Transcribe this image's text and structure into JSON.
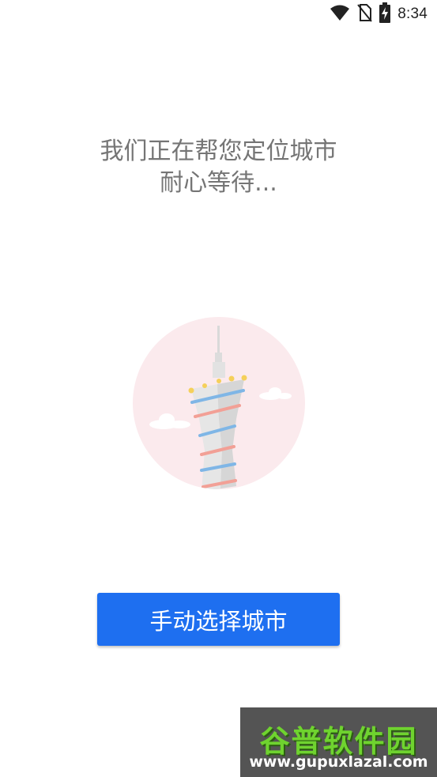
{
  "status_bar": {
    "time": "8:34",
    "icons": [
      "wifi-icon",
      "no-sim-icon",
      "battery-charging-icon"
    ]
  },
  "locating": {
    "line1": "我们正在帮您定位城市",
    "line2": "耐心等待..."
  },
  "illustration": {
    "icon": "canton-tower-icon",
    "colors": {
      "circle": "#fbeaed",
      "tower": "#e6e6e6",
      "stripe_blue": "#7fb6e6",
      "stripe_pink": "#f2a096",
      "lights": "#f5d05a"
    }
  },
  "actions": {
    "choose_city_label": "手动选择城市",
    "button_color": "#1e6ff0"
  },
  "watermark": {
    "logo_text": "谷普软件园",
    "url": "www.gupuxlazal.com"
  }
}
